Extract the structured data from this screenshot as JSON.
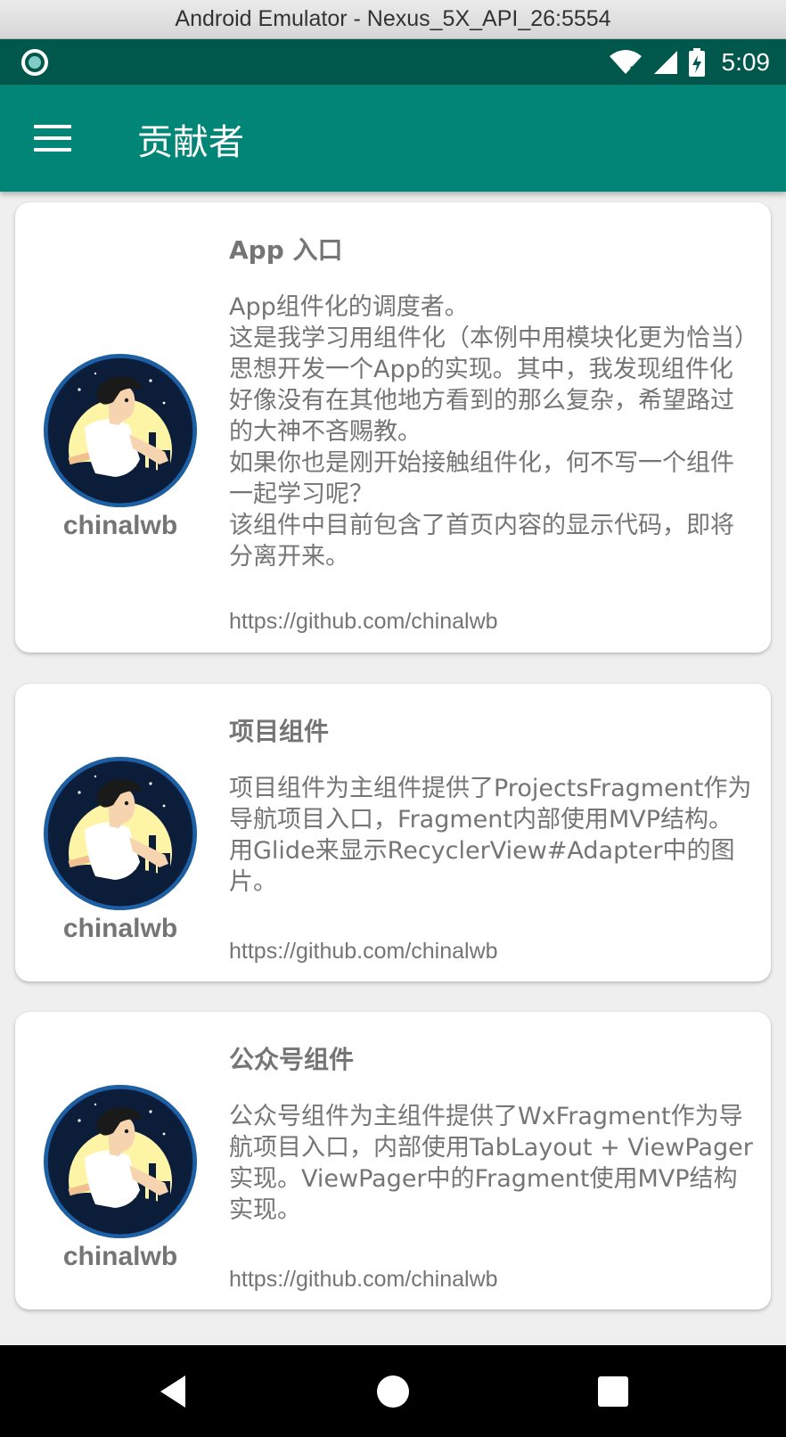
{
  "window": {
    "title": "Android Emulator - Nexus_5X_API_26:5554"
  },
  "status_bar": {
    "time": "5:09",
    "icons": [
      "wifi-icon",
      "signal-icon",
      "battery-charging-icon"
    ]
  },
  "app_bar": {
    "title": "贡献者",
    "menu_icon": "menu-icon"
  },
  "cards": [
    {
      "author": "chinalwb",
      "title": "App 入口",
      "description": "App组件化的调度者。\n这是我学习用组件化（本例中用模块化更为恰当）思想开发一个App的实现。其中，我发现组件化好像没有在其他地方看到的那么复杂，希望路过的大神不吝赐教。\n如果你也是刚开始接触组件化，何不写一个组件一起学习呢？\n该组件中目前包含了首页内容的显示代码，即将分离开来。",
      "link": "https://github.com/chinalwb"
    },
    {
      "author": "chinalwb",
      "title": "项目组件",
      "description": "项目组件为主组件提供了ProjectsFragment作为导航项目入口，Fragment内部使用MVP结构。用Glide来显示RecyclerView#Adapter中的图片。",
      "link": "https://github.com/chinalwb"
    },
    {
      "author": "chinalwb",
      "title": "公众号组件",
      "description": "公众号组件为主组件提供了WxFragment作为导航项目入口，内部使用TabLayout + ViewPager实现。ViewPager中的Fragment使用MVP结构实现。",
      "link": "https://github.com/chinalwb"
    }
  ],
  "nav_bar": {
    "buttons": [
      "back-icon",
      "home-icon",
      "recents-icon"
    ]
  },
  "colors": {
    "primary": "#008577",
    "primary_dark": "#00574b",
    "text_secondary": "#757575"
  }
}
